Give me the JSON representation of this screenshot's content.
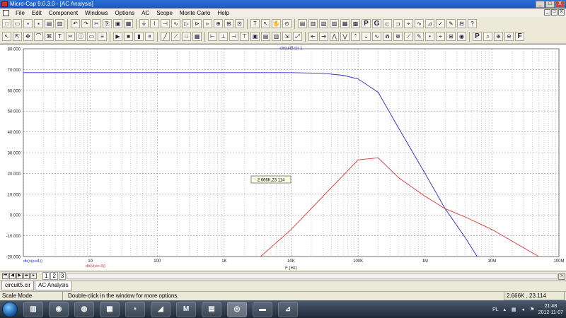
{
  "window": {
    "title": "Micro-Cap 9.0.3.0 - [AC Analysis]",
    "minimize": "_",
    "maximize": "□",
    "close": "X"
  },
  "menu": {
    "items": [
      "File",
      "Edit",
      "Component",
      "Windows",
      "Options",
      "AC",
      "Scope",
      "Monte Carlo",
      "Help"
    ]
  },
  "toolbar2": {
    "p_label": "P",
    "g_label": "G",
    "f_label": "F"
  },
  "plot": {
    "title": "circuit5.cir 1",
    "x_label": "F (Hz)",
    "legend_blue": "db(v(out1))",
    "legend_red": "db(v(vin:3))",
    "cursor_readout": "2.666K,23.114",
    "colors": {
      "blue": "#2b2bcf",
      "red": "#e03030",
      "grid": "#9a9a9a",
      "axis_text": "#202020"
    }
  },
  "chart_data": {
    "type": "line",
    "xscale": "log",
    "xlim": [
      1,
      100000000
    ],
    "ylim": [
      -20,
      80
    ],
    "x_tick_labels": [
      "10",
      "100",
      "1K",
      "10K",
      "100K",
      "1M",
      "10M",
      "100M"
    ],
    "y_tick_labels": [
      "80.000",
      "70.000",
      "60.000",
      "50.000",
      "40.000",
      "30.000",
      "20.000",
      "10.000",
      "0.000",
      "-10.000",
      "-20.000"
    ],
    "xlabel": "F (Hz)",
    "title": "circuit5.cir 1",
    "series": [
      {
        "name": "db(v(out1))",
        "color": "#2b2bcf",
        "x": [
          1,
          10,
          100,
          1000,
          10000,
          30000,
          60000,
          100000,
          200000,
          400000,
          1000000,
          2000000,
          4000000,
          6000000
        ],
        "y": [
          68.5,
          68.5,
          68.5,
          68.5,
          68.5,
          68.2,
          67.2,
          65.5,
          59,
          42,
          20,
          3,
          -11,
          -20
        ]
      },
      {
        "name": "db(v(vin:3))",
        "color": "#e03030",
        "x": [
          3500,
          10000,
          30000,
          100000,
          200000,
          400000,
          1000000,
          2000000,
          4000000,
          10000000,
          50000000
        ],
        "y": [
          -20,
          -7,
          9,
          26.5,
          27.5,
          18,
          9,
          3,
          -1,
          -7,
          -20
        ]
      }
    ],
    "grid": true
  },
  "pagenav": {
    "tabs": [
      "1",
      "2",
      "3"
    ],
    "scroll_right": ">"
  },
  "filetabs": [
    "circuit5.cir",
    "AC Analysis"
  ],
  "status": {
    "mode": "Scale Mode",
    "hint": "Double-click in the window for more options.",
    "coord": "2.666K , 23.114"
  },
  "taskbar": {
    "lang": "PL",
    "time": "21:48",
    "date": "2012-11-07"
  }
}
